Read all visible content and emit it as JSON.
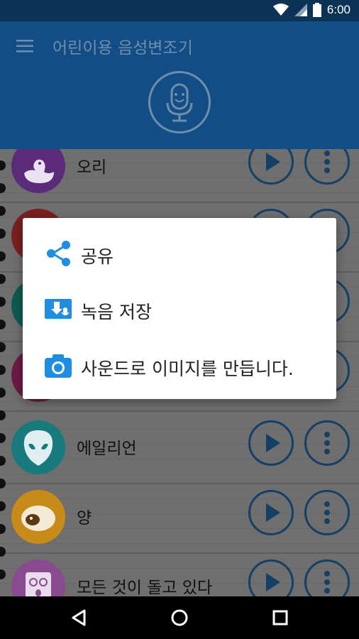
{
  "status_bar": {
    "time": "6:00",
    "icons": [
      "wifi-icon",
      "signal-icon",
      "battery-icon"
    ]
  },
  "app_bar": {
    "title": "어린이용 음성변조기",
    "menu_icon": "hamburger-menu-icon",
    "mic_icon": "microphone-icon"
  },
  "list": {
    "items": [
      {
        "label": "오리",
        "avatar": "duck-icon",
        "color": "#5b2a78"
      },
      {
        "label": "",
        "avatar": "avatar-red-icon",
        "color": "#7a1f1f"
      },
      {
        "label": "",
        "avatar": "avatar-teal-icon",
        "color": "#0f5a4f"
      },
      {
        "label": "",
        "avatar": "avatar-pink-icon",
        "color": "#6e1a45"
      },
      {
        "label": "에일리언",
        "avatar": "alien-icon",
        "color": "#197a7e"
      },
      {
        "label": "양",
        "avatar": "sheep-icon",
        "color": "#c88b1a"
      },
      {
        "label": "모든 것이 돌고 있다",
        "avatar": "spiral-face-icon",
        "color": "#8a4a8f"
      }
    ]
  },
  "dialog": {
    "items": [
      {
        "label": "공유",
        "icon": "share-icon"
      },
      {
        "label": "녹음 저장",
        "icon": "save-recording-icon"
      },
      {
        "label": "사운드로 이미지를 만듭니다.",
        "icon": "camera-icon"
      }
    ],
    "accent": "#1f8de0"
  },
  "nav_bar": {
    "buttons": [
      "back-icon",
      "home-icon",
      "recents-icon"
    ]
  }
}
